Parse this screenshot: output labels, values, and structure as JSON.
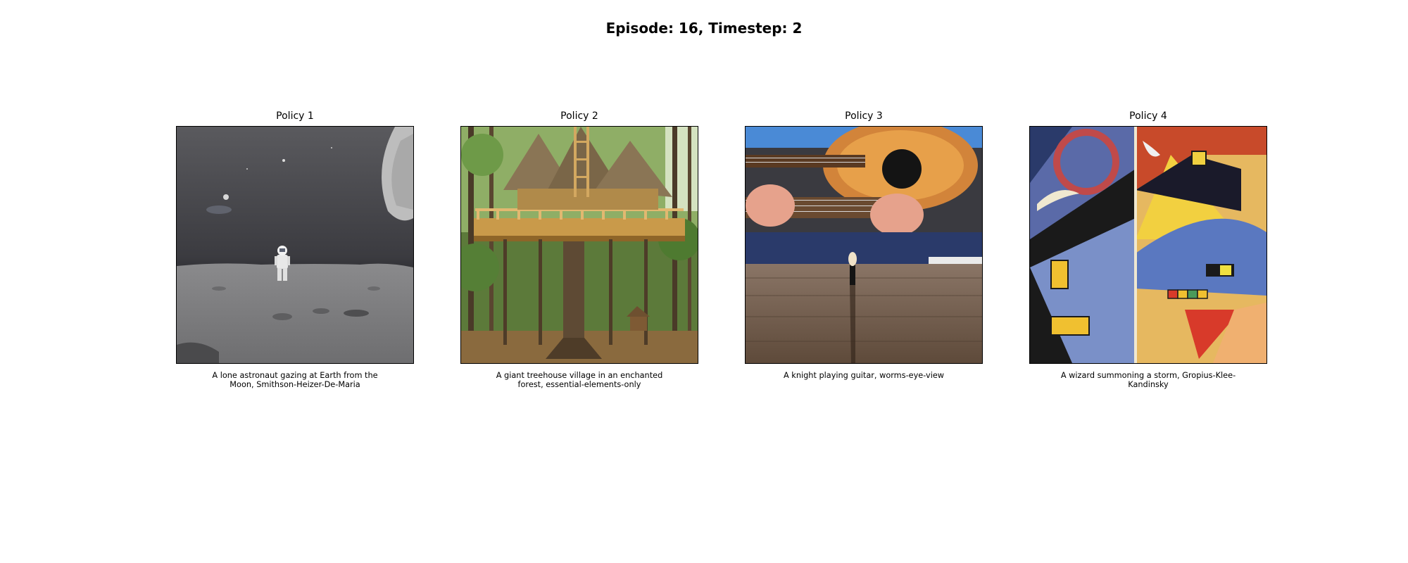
{
  "figure": {
    "title": "Episode: 16, Timestep: 2"
  },
  "panels": [
    {
      "title": "Policy 1",
      "image_subject": "astronaut-on-moon",
      "caption": "A lone astronaut gazing at Earth from the Moon, Smithson-Heizer-De-Maria"
    },
    {
      "title": "Policy 2",
      "image_subject": "forest-treehouse",
      "caption": "A giant treehouse village in an enchanted forest, essential-elements-only"
    },
    {
      "title": "Policy 3",
      "image_subject": "guitar-player-worms-eye",
      "caption": "A knight playing guitar, worms-eye-view"
    },
    {
      "title": "Policy 4",
      "image_subject": "abstract-geometric-painting",
      "caption": "A wizard summoning a storm, Gropius-Klee-Kandinsky"
    }
  ]
}
